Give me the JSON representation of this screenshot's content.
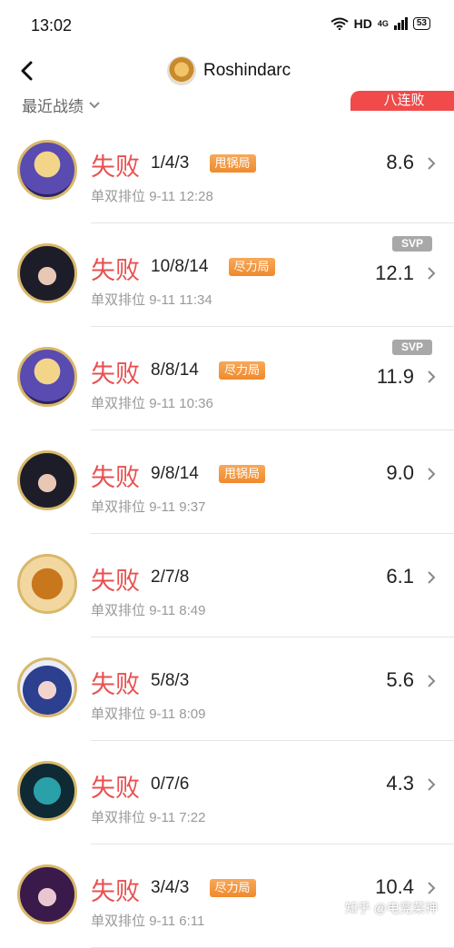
{
  "status": {
    "time": "13:02",
    "hd": "HD",
    "signal": "4G",
    "battery": "53",
    "icons": [
      "wifi-icon",
      "signal-icon",
      "battery-icon"
    ]
  },
  "header": {
    "back_icon": "chevron-left-icon",
    "title": "Roshindarc"
  },
  "subheader": {
    "label": "最近战绩",
    "streak": "八连败"
  },
  "matches": [
    {
      "result": "失败",
      "kda": "1/4/3",
      "tag": "甩锅局",
      "mode": "单双排位",
      "time": "9-11 12:28",
      "score": "8.6",
      "svp": ""
    },
    {
      "result": "失败",
      "kda": "10/8/14",
      "tag": "尽力局",
      "mode": "单双排位",
      "time": "9-11 11:34",
      "score": "12.1",
      "svp": "SVP"
    },
    {
      "result": "失败",
      "kda": "8/8/14",
      "tag": "尽力局",
      "mode": "单双排位",
      "time": "9-11 10:36",
      "score": "11.9",
      "svp": "SVP"
    },
    {
      "result": "失败",
      "kda": "9/8/14",
      "tag": "甩锅局",
      "mode": "单双排位",
      "time": "9-11 9:37",
      "score": "9.0",
      "svp": ""
    },
    {
      "result": "失败",
      "kda": "2/7/8",
      "tag": "",
      "mode": "单双排位",
      "time": "9-11 8:49",
      "score": "6.1",
      "svp": ""
    },
    {
      "result": "失败",
      "kda": "5/8/3",
      "tag": "",
      "mode": "单双排位",
      "time": "9-11 8:09",
      "score": "5.6",
      "svp": ""
    },
    {
      "result": "失败",
      "kda": "0/7/6",
      "tag": "",
      "mode": "单双排位",
      "time": "9-11 7:22",
      "score": "4.3",
      "svp": ""
    },
    {
      "result": "失败",
      "kda": "3/4/3",
      "tag": "尽力局",
      "mode": "单双排位",
      "time": "9-11 6:11",
      "score": "10.4",
      "svp": ""
    }
  ],
  "watermark": "知乎 @电竞菜神",
  "colors": {
    "lose": "#e85050",
    "badge": "#f04a4a",
    "tag": "#f08a2c",
    "svp": "#a8a8a8"
  }
}
